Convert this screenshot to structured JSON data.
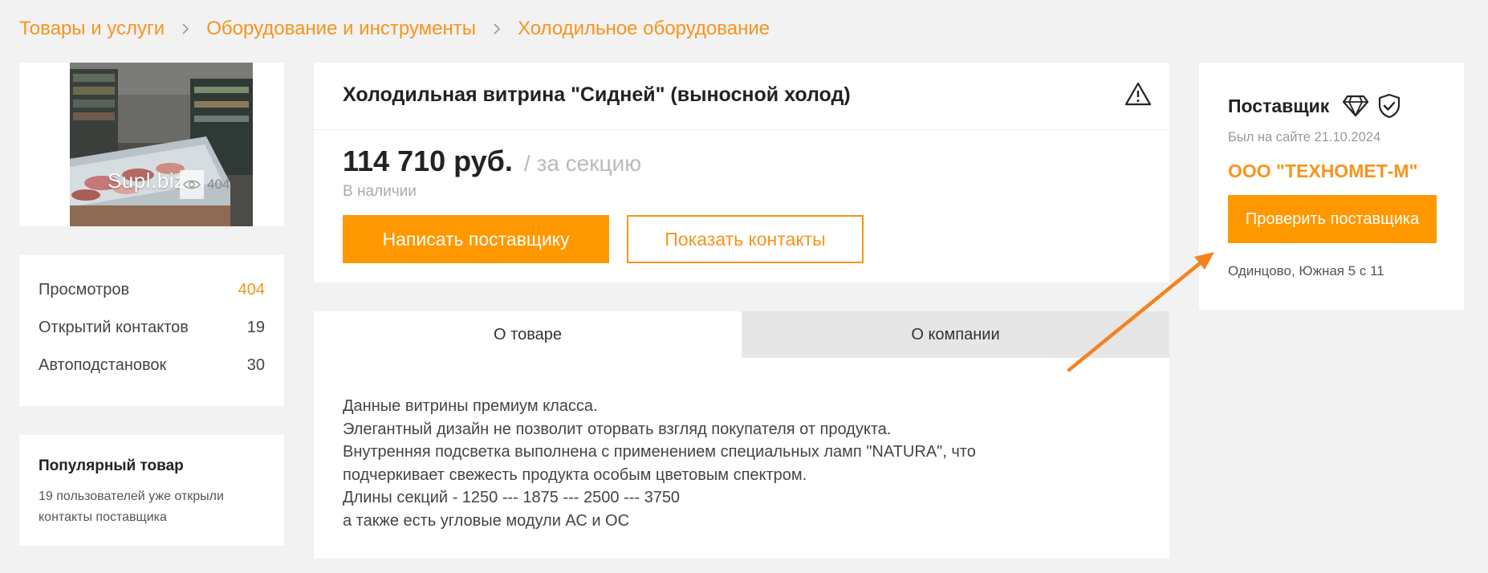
{
  "breadcrumb": [
    "Товары и услуги",
    "Оборудование и инструменты",
    "Холодильное оборудование"
  ],
  "photo": {
    "watermark": "Supl.biz",
    "views": "404",
    "icon": "eye-icon"
  },
  "stats": [
    {
      "label": "Просмотров",
      "value": "404"
    },
    {
      "label": "Открытий контактов",
      "value": "19"
    },
    {
      "label": "Автоподстановок",
      "value": "30"
    }
  ],
  "popular": {
    "title": "Популярный товар",
    "text": "19 пользователей уже открыли контакты поставщика"
  },
  "product": {
    "title": "Холодильная витрина \"Сидней\" (выносной холод)",
    "price": "114 710 руб.",
    "unit": "/ за секцию",
    "stock": "В наличии",
    "write_button": "Написать поставщику",
    "contacts_button": "Показать контакты"
  },
  "tabs": [
    {
      "label": "О товаре"
    },
    {
      "label": "О компании"
    }
  ],
  "description": [
    "Данные витрины премиум класса.",
    "Элегантный дизайн не позволит оторвать взгляд покупателя от продукта.",
    "Внутренняя подсветка выполнена с применением специальных ламп \"NATURA\", что подчеркивает свежесть продукта особым цветовым спектром.",
    "Длины секций - 1250 --- 1875 --- 2500 --- 3750",
    "а также есть угловые модули АС и ОС"
  ],
  "supplier": {
    "title": "Поставщик",
    "last_seen": "Был на сайте 21.10.2024",
    "company": "ООО \"ТЕХНОМЕТ-М\"",
    "check_button": "Проверить поставщика",
    "address": "Одинцово, Южная 5 с 11"
  },
  "colors": {
    "accent": "#ff9800",
    "link": "#f7941d",
    "background": "#f2f2f2",
    "card": "#ffffff",
    "arrow": "#f58220"
  }
}
